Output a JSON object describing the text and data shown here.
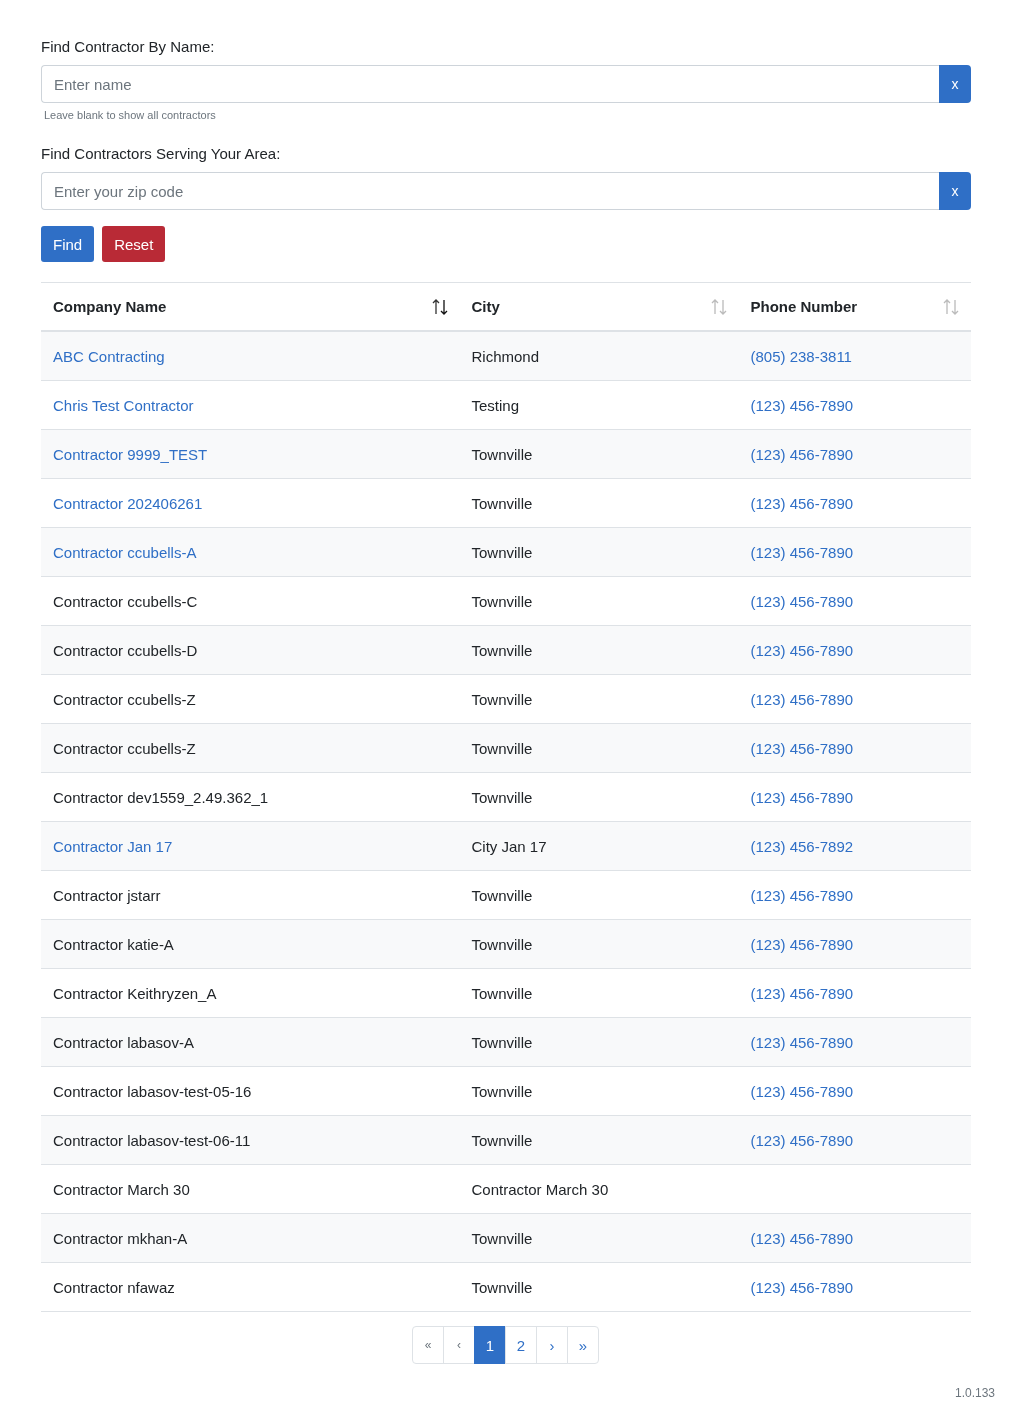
{
  "name_search": {
    "label": "Find Contractor By Name:",
    "placeholder": "Enter name",
    "clear_button": "x",
    "help": "Leave blank to show all contractors"
  },
  "zip_search": {
    "label": "Find Contractors Serving Your Area:",
    "placeholder": "Enter your zip code",
    "clear_button": "x"
  },
  "buttons": [
    {
      "kind": "primary",
      "label": "Find"
    },
    {
      "kind": "danger",
      "label": "Reset"
    }
  ],
  "table": {
    "columns": [
      {
        "label": "Company Name",
        "sorted": true
      },
      {
        "label": "City",
        "sorted": false
      },
      {
        "label": "Phone Number",
        "sorted": false
      }
    ],
    "rows": [
      {
        "company": "ABC Contracting",
        "link": true,
        "city": "Richmond",
        "phone": "(805) 238-3811"
      },
      {
        "company": "Chris Test Contractor",
        "link": true,
        "city": "Testing",
        "phone": "(123) 456-7890"
      },
      {
        "company": "Contractor 9999_TEST",
        "link": true,
        "city": "Townville",
        "phone": "(123) 456-7890"
      },
      {
        "company": "Contractor 202406261",
        "link": true,
        "city": "Townville",
        "phone": "(123) 456-7890"
      },
      {
        "company": "Contractor ccubells-A",
        "link": true,
        "city": "Townville",
        "phone": "(123) 456-7890"
      },
      {
        "company": "Contractor ccubells-C",
        "link": false,
        "city": "Townville",
        "phone": "(123) 456-7890"
      },
      {
        "company": "Contractor ccubells-D",
        "link": false,
        "city": "Townville",
        "phone": "(123) 456-7890"
      },
      {
        "company": "Contractor ccubells-Z",
        "link": false,
        "city": "Townville",
        "phone": "(123) 456-7890"
      },
      {
        "company": "Contractor ccubells-Z",
        "link": false,
        "city": "Townville",
        "phone": "(123) 456-7890"
      },
      {
        "company": "Contractor dev1559_2.49.362_1",
        "link": false,
        "city": "Townville",
        "phone": "(123) 456-7890"
      },
      {
        "company": "Contractor Jan 17",
        "link": true,
        "city": "City Jan 17",
        "phone": "(123) 456-7892"
      },
      {
        "company": "Contractor jstarr",
        "link": false,
        "city": "Townville",
        "phone": "(123) 456-7890"
      },
      {
        "company": "Contractor katie-A",
        "link": false,
        "city": "Townville",
        "phone": "(123) 456-7890"
      },
      {
        "company": "Contractor Keithryzen_A",
        "link": false,
        "city": "Townville",
        "phone": "(123) 456-7890"
      },
      {
        "company": "Contractor labasov-A",
        "link": false,
        "city": "Townville",
        "phone": "(123) 456-7890"
      },
      {
        "company": "Contractor labasov-test-05-16",
        "link": false,
        "city": "Townville",
        "phone": "(123) 456-7890"
      },
      {
        "company": "Contractor labasov-test-06-11",
        "link": false,
        "city": "Townville",
        "phone": "(123) 456-7890"
      },
      {
        "company": "Contractor March 30",
        "link": false,
        "city": "Contractor March 30"
      },
      {
        "company": "Contractor mkhan-A",
        "link": false,
        "city": "Townville",
        "phone": "(123) 456-7890"
      },
      {
        "company": "Contractor nfawaz",
        "link": false,
        "city": "Townville",
        "phone": "(123) 456-7890"
      }
    ]
  },
  "pagination": [
    {
      "label": "«",
      "selected": false,
      "disabled": true
    },
    {
      "label": "‹",
      "selected": false,
      "disabled": true
    },
    {
      "label": "1",
      "selected": true,
      "disabled": false
    },
    {
      "label": "2",
      "selected": false,
      "disabled": false
    },
    {
      "label": "›",
      "selected": false,
      "disabled": false
    },
    {
      "label": "»",
      "selected": false,
      "disabled": false
    }
  ],
  "version": "1.0.133"
}
